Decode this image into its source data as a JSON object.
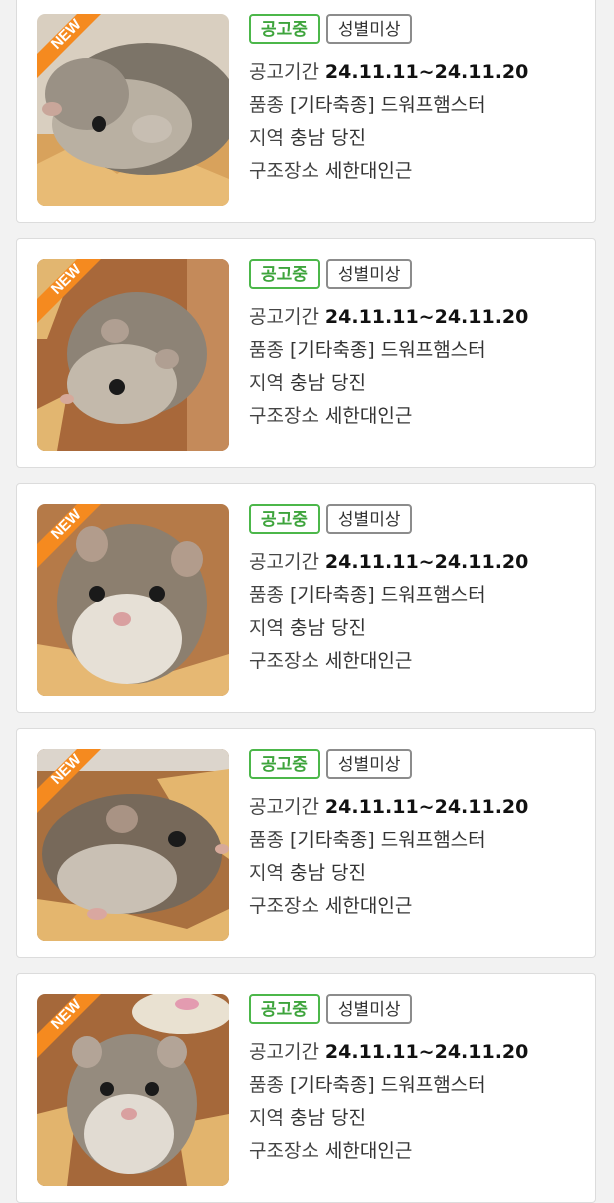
{
  "list": {
    "items": [
      {
        "ribbon": "NEW",
        "status": "공고중",
        "gender": "성별미상",
        "period_label": "공고기간",
        "period": "24.11.11~24.11.20",
        "breed_label": "품종",
        "breed": "[기타축종] 드워프햄스터",
        "region_label": "지역",
        "region": "충남 당진",
        "rescue_label": "구조장소",
        "rescue": "세한대인근"
      },
      {
        "ribbon": "NEW",
        "status": "공고중",
        "gender": "성별미상",
        "period_label": "공고기간",
        "period": "24.11.11~24.11.20",
        "breed_label": "품종",
        "breed": "[기타축종] 드워프햄스터",
        "region_label": "지역",
        "region": "충남 당진",
        "rescue_label": "구조장소",
        "rescue": "세한대인근"
      },
      {
        "ribbon": "NEW",
        "status": "공고중",
        "gender": "성별미상",
        "period_label": "공고기간",
        "period": "24.11.11~24.11.20",
        "breed_label": "품종",
        "breed": "[기타축종] 드워프햄스터",
        "region_label": "지역",
        "region": "충남 당진",
        "rescue_label": "구조장소",
        "rescue": "세한대인근"
      },
      {
        "ribbon": "NEW",
        "status": "공고중",
        "gender": "성별미상",
        "period_label": "공고기간",
        "period": "24.11.11~24.11.20",
        "breed_label": "품종",
        "breed": "[기타축종] 드워프햄스터",
        "region_label": "지역",
        "region": "충남 당진",
        "rescue_label": "구조장소",
        "rescue": "세한대인근"
      },
      {
        "ribbon": "NEW",
        "status": "공고중",
        "gender": "성별미상",
        "period_label": "공고기간",
        "period": "24.11.11~24.11.20",
        "breed_label": "품종",
        "breed": "[기타축종] 드워프햄스터",
        "region_label": "지역",
        "region": "충남 당진",
        "rescue_label": "구조장소",
        "rescue": "세한대인근"
      }
    ]
  },
  "colors": {
    "status_green": "#4cb74a",
    "ribbon_orange": "#f58a1f",
    "page_background": "#f2f2f2"
  }
}
